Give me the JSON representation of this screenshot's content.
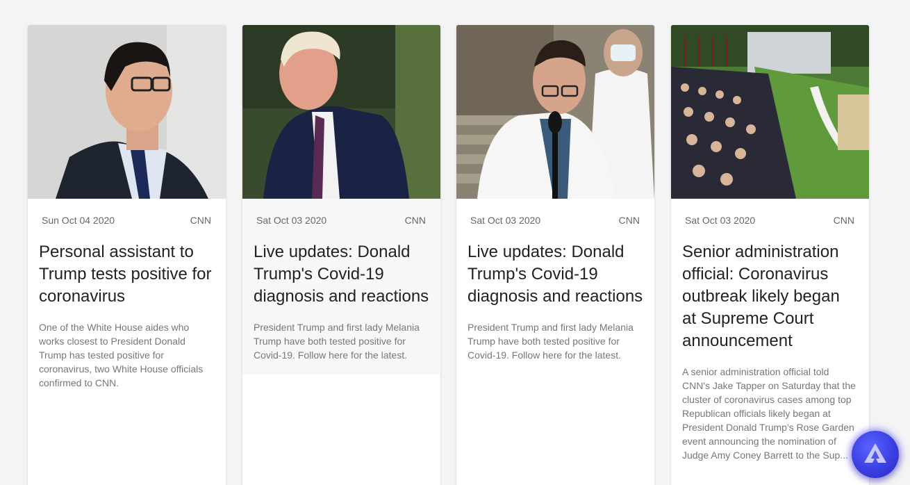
{
  "articles": [
    {
      "image": "photo-man-glasses-suit",
      "date": "Sun Oct 04 2020",
      "source": "CNN",
      "title": "Personal assistant to Trump tests positive for coronavirus",
      "description": "One of the White House aides who works closest to President Donald Trump has tested positive for coronavirus, two White House officials confirmed to CNN."
    },
    {
      "image": "photo-donald-trump",
      "date": "Sat Oct 03 2020",
      "source": "CNN",
      "title": "Live updates: Donald Trump's Covid-19 diagnosis and reactions",
      "description": "President Trump and first lady Melania Trump have both tested positive for Covid-19. Follow here for the latest."
    },
    {
      "image": "photo-doctor-press-briefing",
      "date": "Sat Oct 03 2020",
      "source": "CNN",
      "title": "Live updates: Donald Trump's Covid-19 diagnosis and reactions",
      "description": "President Trump and first lady Melania Trump have both tested positive for Covid-19. Follow here for the latest."
    },
    {
      "image": "photo-rose-garden-event",
      "date": "Sat Oct 03 2020",
      "source": "CNN",
      "title": "Senior administration official: Coronavirus outbreak likely began at Supreme Court announcement",
      "description": "A senior administration official told CNN's Jake Tapper on Saturday that the cluster of coronavirus cases among top Republican officials likely began at President Donald Trump's Rose Garden event announcing the nomination of Judge Amy Coney Barrett to the Sup..."
    }
  ],
  "fab": {
    "icon": "triangle-logo-icon"
  },
  "colors": {
    "background": "#f4f4f4",
    "card": "#ffffff",
    "fab": "#3b3fe0"
  }
}
